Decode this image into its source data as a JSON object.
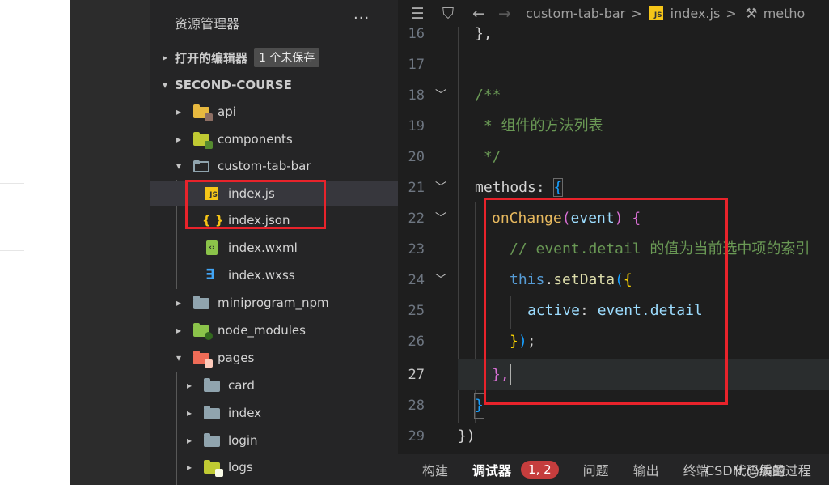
{
  "explorer": {
    "title": "资源管理器",
    "more": "···",
    "open_editors": {
      "label": "打开的编辑器",
      "badge": "1 个未保存"
    },
    "project": {
      "label": "SECOND-COURSE"
    },
    "items": [
      {
        "label": "api",
        "icon": "folder-api-icon",
        "chevron": "▸"
      },
      {
        "label": "components",
        "icon": "folder-components-icon",
        "chevron": "▸"
      },
      {
        "label": "custom-tab-bar",
        "icon": "folder-open-icon",
        "chevron": "▾"
      },
      {
        "label": "index.js",
        "icon": "js-file-icon"
      },
      {
        "label": "index.json",
        "icon": "json-file-icon"
      },
      {
        "label": "index.wxml",
        "icon": "wxml-file-icon"
      },
      {
        "label": "index.wxss",
        "icon": "wxss-file-icon"
      },
      {
        "label": "miniprogram_npm",
        "icon": "folder-icon",
        "chevron": "▸"
      },
      {
        "label": "node_modules",
        "icon": "folder-node-icon",
        "chevron": "▸"
      },
      {
        "label": "pages",
        "icon": "folder-pages-icon",
        "chevron": "▾"
      },
      {
        "label": "card",
        "icon": "folder-icon",
        "chevron": "▸"
      },
      {
        "label": "index",
        "icon": "folder-icon",
        "chevron": "▸"
      },
      {
        "label": "login",
        "icon": "folder-icon",
        "chevron": "▸"
      },
      {
        "label": "logs",
        "icon": "folder-logs-icon",
        "chevron": "▸"
      }
    ]
  },
  "toolbar": {
    "list_icon": "☰",
    "bookmark_icon": "⛉",
    "back_icon": "←",
    "forward_icon": "→",
    "crumbs": [
      "custom-tab-bar",
      "index.js",
      "metho"
    ],
    "sep": ">",
    "js_badge": "JS"
  },
  "editor": {
    "lines": [
      {
        "n": "16",
        "text": "},"
      },
      {
        "n": "17",
        "text": ""
      },
      {
        "n": "18",
        "text": "/**"
      },
      {
        "n": "19",
        "text": " * 组件的方法列表"
      },
      {
        "n": "20",
        "text": " */"
      },
      {
        "n": "21",
        "key": "methods",
        "colon": ": ",
        "brace": "{"
      },
      {
        "n": "22",
        "fn": "onChange",
        "lp": "(",
        "param": "event",
        "rp": ")",
        "brace": " {"
      },
      {
        "n": "23",
        "comment": "// event.detail 的值为当前选中项的索引"
      },
      {
        "n": "24",
        "obj": "this",
        "dot": ".",
        "method": "setData",
        "lp": "(",
        "brace": "{"
      },
      {
        "n": "25",
        "key": "active",
        "colon": ": ",
        "value": "event.detail"
      },
      {
        "n": "26",
        "brace": "}",
        "rp": ")",
        "semi": ";"
      },
      {
        "n": "27",
        "brace": "},",
        "current": true
      },
      {
        "n": "28",
        "brace": "}"
      },
      {
        "n": "29",
        "brace": "})"
      }
    ]
  },
  "bottom": {
    "tabs": [
      "构建",
      "调试器",
      "问题",
      "输出",
      "终端",
      "代码质量"
    ],
    "badge": "1, 2"
  },
  "watermark": "CSDN @编的过程",
  "colors": {
    "highlight": "#e8232b",
    "selected_row": "#37373d"
  }
}
